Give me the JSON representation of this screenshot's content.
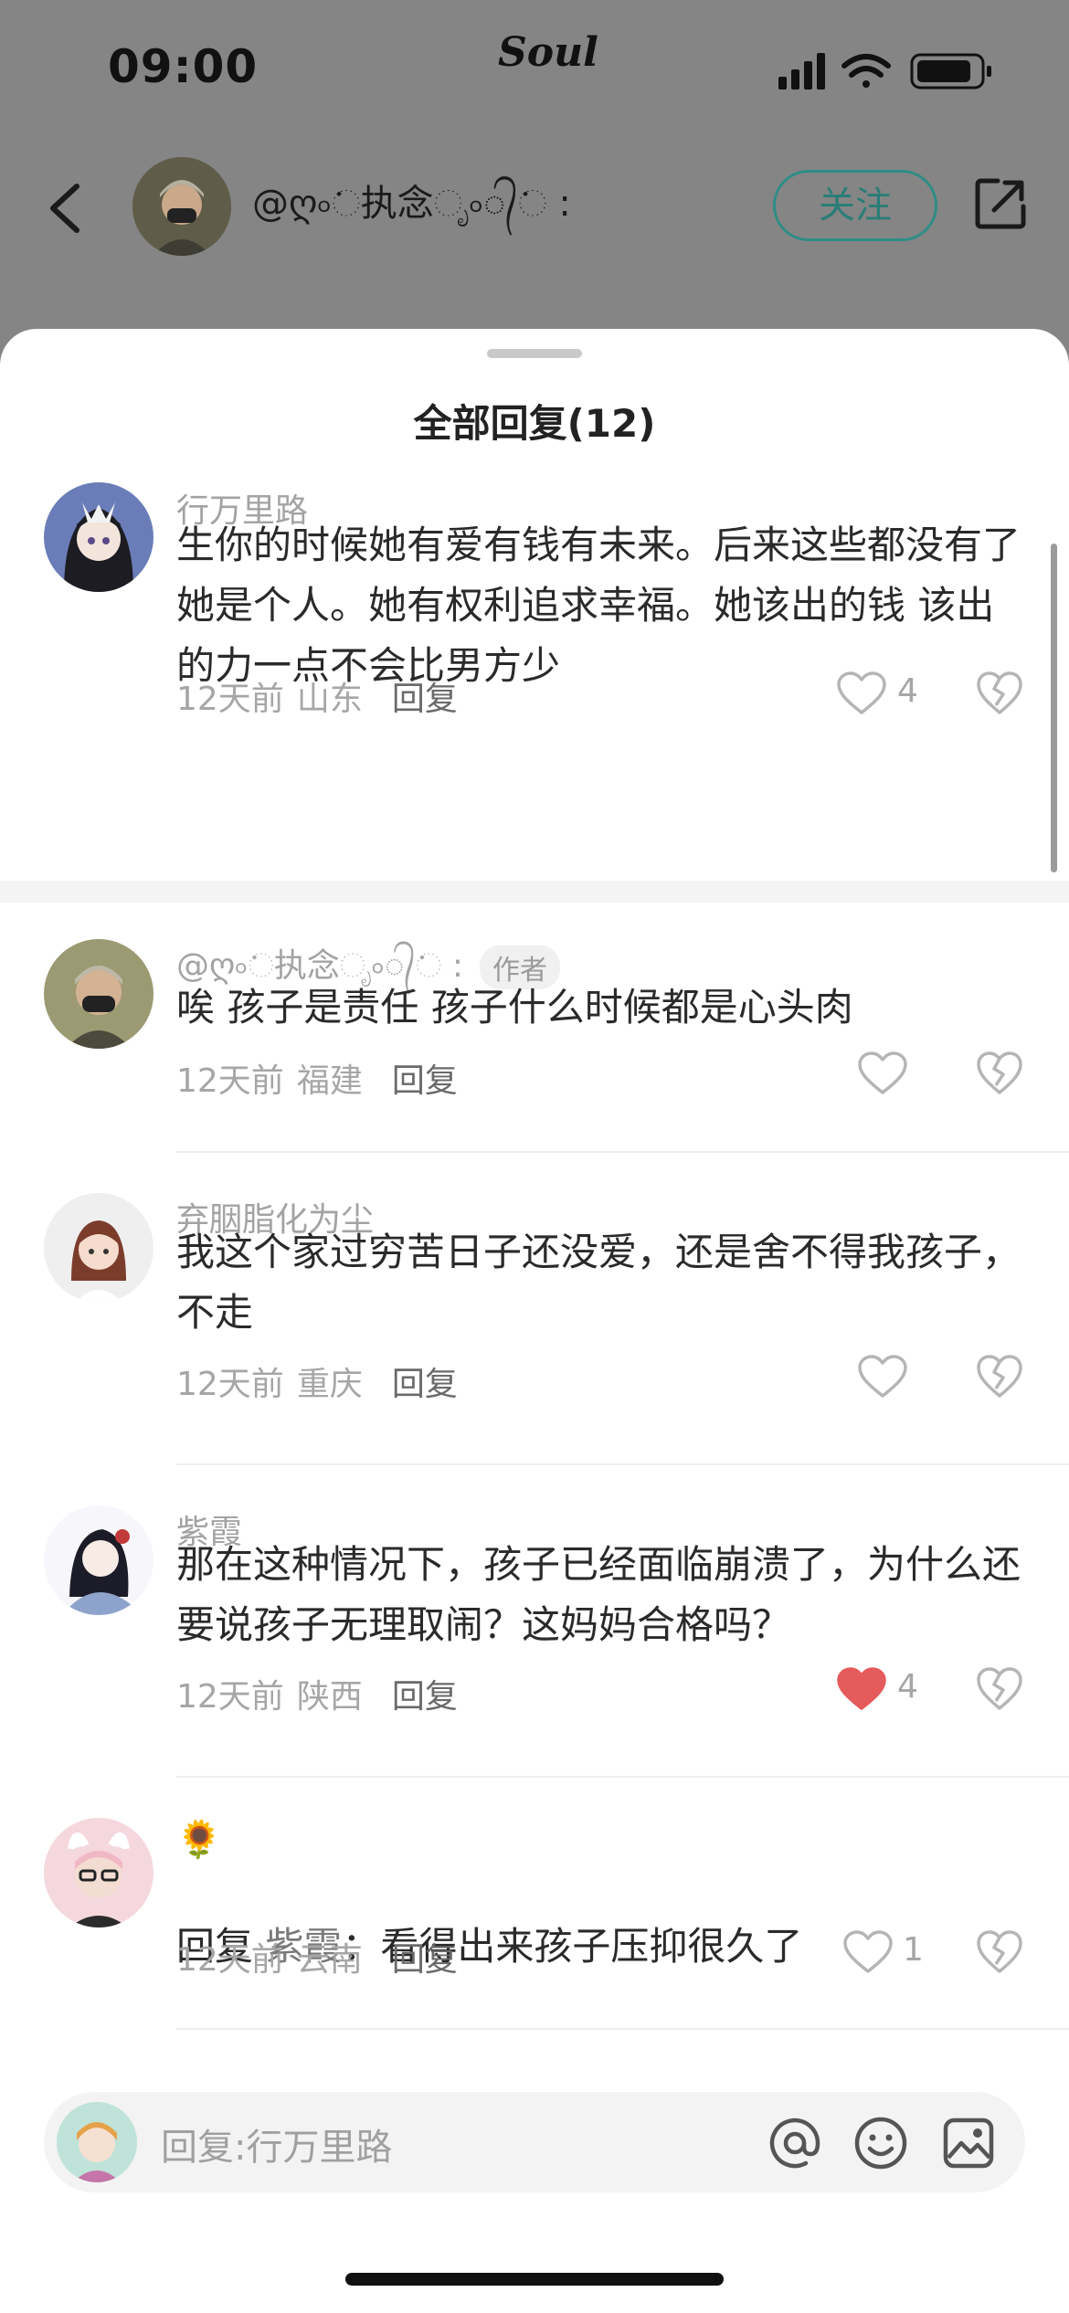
{
  "status_bar": {
    "time": "09:00",
    "app_name": "Soul"
  },
  "header": {
    "back_icon": "chevron-left-icon",
    "user_name": "@ღ৹ᨗ执念ೃ৹᭄ᨗ : ",
    "follow_label": "关注",
    "share_icon": "share-external-icon"
  },
  "sheet": {
    "title": "全部回复(12)",
    "comments": [
      {
        "name": "行万里路",
        "text": "生你的时候她有爱有钱有未来。后来这些都没有了\n她是个人。她有权利追求幸福。她该出的钱 该出的力一点不会比男方少",
        "time": "12天前",
        "location": "山东",
        "reply_label": "回复",
        "likes": "4",
        "liked": false
      },
      {
        "name": "@ღ৹ᨗ执念ೃ৹᭄ᨗ :",
        "author_tag": "作者",
        "text": "唉 孩子是责任 孩子什么时候都是心头肉",
        "time": "12天前",
        "location": "福建",
        "reply_label": "回复",
        "likes": "",
        "liked": false
      },
      {
        "name": "弃胭脂化为尘",
        "text": "我这个家过穷苦日子还没爱，还是舍不得我孩子，不走",
        "time": "12天前",
        "location": "重庆",
        "reply_label": "回复",
        "likes": "",
        "liked": false
      },
      {
        "name": "紫霞",
        "text": "那在这种情况下，孩子已经面临崩溃了，为什么还要说孩子无理取闹？这妈妈合格吗？",
        "time": "12天前",
        "location": "陕西",
        "reply_label": "回复",
        "likes": "4",
        "liked": true
      },
      {
        "name": "🌻",
        "reply_prefix": "回复",
        "reply_target": "紫霞",
        "text": "：看得出来孩子压抑很久了",
        "time": "12天前",
        "location": "云南",
        "reply_label": "回复",
        "likes": "1",
        "liked": false
      }
    ]
  },
  "input": {
    "placeholder": "回复:行万里路",
    "icons": [
      "at-icon",
      "emoji-icon",
      "image-icon"
    ]
  },
  "colors": {
    "accent": "#2e8d86",
    "liked": "#e55a5a",
    "muted": "#a6a6a6"
  }
}
